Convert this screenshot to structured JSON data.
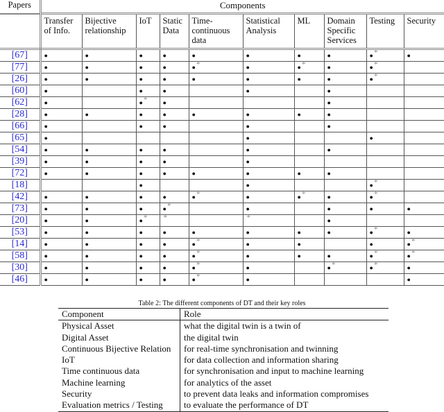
{
  "table1": {
    "papers_header": "Papers",
    "components_header": "Components",
    "columns": [
      "Transfer of Info.",
      "Bijective relationship",
      "IoT",
      "Static Data",
      "Time-continuous data",
      "Statistical Analysis",
      "ML",
      "Domain Specific Services",
      "Testing",
      "Security"
    ],
    "legend": {
      "full": "●",
      "partial": "*"
    },
    "rows": [
      {
        "ref": "[67]",
        "cells": [
          "●",
          "●",
          "●",
          "●",
          "●",
          "●",
          "●",
          "●",
          "●*",
          "●"
        ]
      },
      {
        "ref": "[77]",
        "cells": [
          "●",
          "●",
          "●",
          "●",
          "●*",
          "●",
          "●*",
          "●",
          "●*",
          ""
        ]
      },
      {
        "ref": "[26]",
        "cells": [
          "●",
          "●",
          "●",
          "●",
          "●",
          "●",
          "●",
          "●",
          "●*",
          ""
        ]
      },
      {
        "ref": "[60]",
        "cells": [
          "●",
          "",
          "●",
          "●",
          "",
          "●",
          "",
          "●",
          "",
          ""
        ]
      },
      {
        "ref": "[62]",
        "cells": [
          "●",
          "",
          "●*",
          "●",
          "",
          "",
          "",
          "●",
          "",
          ""
        ]
      },
      {
        "ref": "[28]",
        "cells": [
          "●",
          "●",
          "●",
          "●",
          "●",
          "●",
          "●",
          "●",
          "",
          ""
        ]
      },
      {
        "ref": "[66]",
        "cells": [
          "●",
          "",
          "●",
          "●",
          "",
          "●",
          "",
          "●",
          "",
          ""
        ]
      },
      {
        "ref": "[65]",
        "cells": [
          "●",
          "",
          "",
          "",
          "",
          "●",
          "",
          "",
          "●",
          ""
        ]
      },
      {
        "ref": "[54]",
        "cells": [
          "●",
          "●",
          "●",
          "●",
          "",
          "●",
          "",
          "●",
          "",
          ""
        ]
      },
      {
        "ref": "[39]",
        "cells": [
          "●",
          "●",
          "●",
          "●",
          "",
          "●",
          "",
          "",
          "",
          ""
        ]
      },
      {
        "ref": "[72]",
        "cells": [
          "●",
          "●",
          "●",
          "●",
          "●",
          "●",
          "●",
          "●",
          "",
          ""
        ]
      },
      {
        "ref": "[18]",
        "cells": [
          "",
          "",
          "●",
          "",
          "",
          "●",
          "",
          "",
          "●*",
          ""
        ]
      },
      {
        "ref": "[42]",
        "cells": [
          "●",
          "●",
          "●",
          "●",
          "●*",
          "●",
          "●*",
          "●",
          "●*",
          ""
        ]
      },
      {
        "ref": "[73]",
        "cells": [
          "●",
          "●",
          "●",
          "●*",
          "",
          "●",
          "",
          "●",
          "●",
          "●"
        ]
      },
      {
        "ref": "[20]",
        "cells": [
          "●",
          "●",
          "●*",
          "*",
          "",
          "*",
          "",
          "●",
          "",
          ""
        ]
      },
      {
        "ref": "[53]",
        "cells": [
          "●",
          "●",
          "●",
          "●",
          "●",
          "●",
          "●",
          "●",
          "●*",
          "●"
        ]
      },
      {
        "ref": "[14]",
        "cells": [
          "●",
          "●",
          "●",
          "●",
          "●*",
          "●",
          "●",
          "",
          "●",
          "●*"
        ]
      },
      {
        "ref": "[58]",
        "cells": [
          "●",
          "●",
          "●",
          "●",
          "●*",
          "●",
          "●",
          "●",
          "●*",
          "●*"
        ]
      },
      {
        "ref": "[30]",
        "cells": [
          "●",
          "●",
          "●",
          "●",
          "●*",
          "●",
          "",
          "●*",
          "●*",
          "●"
        ]
      },
      {
        "ref": "[46]",
        "cells": [
          "●",
          "●",
          "●",
          "●",
          "●*",
          "●",
          "",
          "",
          "",
          "●"
        ]
      }
    ]
  },
  "table2": {
    "caption": "Table 2: The different components of DT and their key roles",
    "headers": [
      "Component",
      "Role"
    ],
    "rows": [
      {
        "component": "Physical Asset",
        "role": "what the digital twin is a twin of"
      },
      {
        "component": "Digital Asset",
        "role": "the digital twin"
      },
      {
        "component": "Continuous Bijective Relation",
        "role": "for real-time synchronisation and twinning"
      },
      {
        "component": "IoT",
        "role": "for data collection and information sharing"
      },
      {
        "component": "Time continuous data",
        "role": "for synchronisation and input to machine learning"
      },
      {
        "component": "Machine learning",
        "role": "for analytics of the asset"
      },
      {
        "component": "Security",
        "role": "to prevent data leaks and information compromises"
      },
      {
        "component": "Evaluation metrics / Testing",
        "role": "to evaluate the performance of DT"
      }
    ]
  }
}
